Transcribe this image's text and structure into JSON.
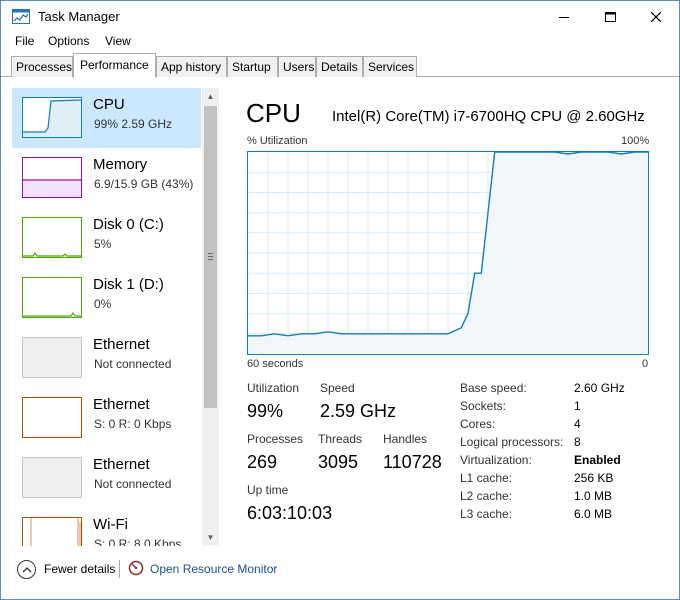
{
  "window": {
    "title": "Task Manager",
    "accent": "#117dbb"
  },
  "menu": [
    "File",
    "Options",
    "View"
  ],
  "tabs": [
    "Processes",
    "Performance",
    "App history",
    "Startup",
    "Users",
    "Details",
    "Services"
  ],
  "active_tab": "Performance",
  "sidebar": {
    "items": [
      {
        "name": "CPU",
        "sub": "99% 2.59 GHz",
        "color": "#117dbb",
        "selected": true,
        "icon": "cpu-graph-icon"
      },
      {
        "name": "Memory",
        "sub": "6.9/15.9 GB (43%)",
        "color": "#8b12ae",
        "icon": "memory-graph-icon"
      },
      {
        "name": "Disk 0 (C:)",
        "sub": "5%",
        "color": "#4da60c",
        "icon": "disk-graph-icon"
      },
      {
        "name": "Disk 1 (D:)",
        "sub": "0%",
        "color": "#4da60c",
        "icon": "disk-graph-icon"
      },
      {
        "name": "Ethernet",
        "sub": "Not connected",
        "color": "#a0a0a0",
        "icon": "ethernet-graph-icon"
      },
      {
        "name": "Ethernet",
        "sub": "S: 0 R: 0 Kbps",
        "color": "#a74f01",
        "icon": "ethernet-graph-icon"
      },
      {
        "name": "Ethernet",
        "sub": "Not connected",
        "color": "#a0a0a0",
        "icon": "ethernet-graph-icon"
      },
      {
        "name": "Wi-Fi",
        "sub": "S: 0 R: 8.0 Kbps",
        "color": "#a74f01",
        "icon": "wifi-graph-icon"
      }
    ]
  },
  "main": {
    "title": "CPU",
    "model": "Intel(R) Core(TM) i7-6700HQ CPU @ 2.60GHz",
    "graph_label": "% Utilization",
    "graph_max": "100%",
    "axis_left": "60 seconds",
    "axis_right": "0",
    "stats": {
      "utilization_label": "Utilization",
      "utilization": "99%",
      "speed_label": "Speed",
      "speed": "2.59 GHz",
      "processes_label": "Processes",
      "processes": "269",
      "threads_label": "Threads",
      "threads": "3095",
      "handles_label": "Handles",
      "handles": "110728",
      "uptime_label": "Up time",
      "uptime": "6:03:10:03"
    },
    "specs": [
      {
        "label": "Base speed:",
        "value": "2.60 GHz"
      },
      {
        "label": "Sockets:",
        "value": "1"
      },
      {
        "label": "Cores:",
        "value": "4"
      },
      {
        "label": "Logical processors:",
        "value": "8"
      },
      {
        "label": "Virtualization:",
        "value": "Enabled",
        "bold": true
      },
      {
        "label": "L1 cache:",
        "value": "256 KB"
      },
      {
        "label": "L2 cache:",
        "value": "1.0 MB"
      },
      {
        "label": "L3 cache:",
        "value": "6.0 MB"
      }
    ]
  },
  "chart_data": {
    "type": "area",
    "x_range": [
      60,
      0
    ],
    "ylim": [
      0,
      100
    ],
    "grid": true,
    "x": [
      60,
      58,
      56,
      54,
      52,
      50,
      48,
      46,
      44,
      42,
      40,
      38,
      36,
      34,
      32,
      30,
      28,
      27,
      26,
      25,
      24,
      23,
      22,
      20,
      18,
      16,
      14,
      12,
      10,
      8,
      6,
      4,
      2,
      0
    ],
    "values": [
      9,
      9,
      10,
      9,
      10,
      10,
      11,
      10,
      10,
      10,
      10,
      10,
      10,
      10,
      10,
      10,
      13,
      20,
      40,
      40,
      70,
      100,
      100,
      100,
      100,
      100,
      100,
      99,
      100,
      100,
      100,
      99,
      100,
      100
    ]
  },
  "footer": {
    "fewer_details": "Fewer details",
    "resource_monitor": "Open Resource Monitor"
  }
}
